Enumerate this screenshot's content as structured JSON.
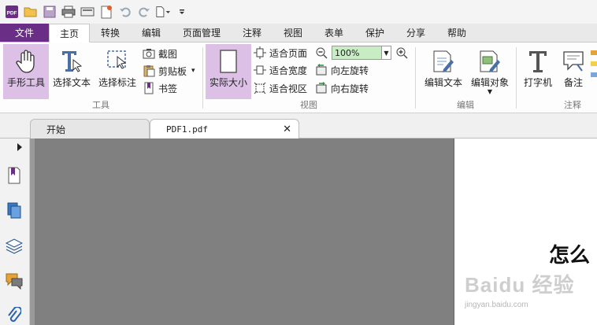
{
  "app": {
    "logo_text": "PDF"
  },
  "menu_tabs": [
    {
      "label": "文件"
    },
    {
      "label": "主页"
    },
    {
      "label": "转换"
    },
    {
      "label": "编辑"
    },
    {
      "label": "页面管理"
    },
    {
      "label": "注释"
    },
    {
      "label": "视图"
    },
    {
      "label": "表单"
    },
    {
      "label": "保护"
    },
    {
      "label": "分享"
    },
    {
      "label": "帮助"
    }
  ],
  "ribbon": {
    "tools": {
      "label": "工具",
      "hand": "手形工具",
      "select_text": "选择文本",
      "select_annotation": "选择标注",
      "screenshot": "截图",
      "clipboard": "剪贴板",
      "bookmark": "书签"
    },
    "view": {
      "label": "视图",
      "actual_size": "实际大小",
      "fit_page": "适合页面",
      "fit_width": "适合宽度",
      "fit_visible": "适合视区",
      "zoom": "100%",
      "rotate_left": "向左旋转",
      "rotate_right": "向右旋转"
    },
    "edit": {
      "label": "编辑",
      "edit_text": "编辑文本",
      "edit_object": "编辑对象"
    },
    "comment": {
      "label": "注释",
      "typewriter": "打字机",
      "note": "备注"
    }
  },
  "doc_tabs": [
    {
      "label": "开始"
    },
    {
      "label": "PDF1.pdf"
    }
  ],
  "document": {
    "visible_text": "怎么"
  },
  "watermark": {
    "brand": "Baidu 经验",
    "url": "jingyan.baidu.com"
  },
  "colors": {
    "accent": "#6a2e86",
    "selected": "#dcc0e6",
    "zoom_bg": "#c8ecc4",
    "doc_bg": "#808080"
  }
}
